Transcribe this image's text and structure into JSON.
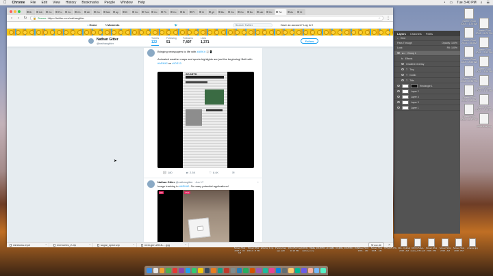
{
  "menubar": {
    "apple": "",
    "app": "Chrome",
    "items": [
      "File",
      "Edit",
      "View",
      "History",
      "Bookmarks",
      "People",
      "Window",
      "Help"
    ],
    "time": "Tue 3:40 PM"
  },
  "chrome": {
    "tabs": [
      "Bi",
      "Inb",
      "Co",
      "Pro",
      "Co",
      "Ch",
      "Ali",
      "Go",
      "Nat",
      "ap",
      "El",
      "Co",
      "Tum",
      "Co",
      "Ph",
      "Co",
      "Bi",
      "Pt",
      "hl",
      "git",
      "Bu",
      "Go",
      "Go",
      "Bc",
      "ske",
      "Ho",
      "Tw",
      "Ac",
      "Ci"
    ],
    "active_tab_index": 26,
    "url_secure": "Secure",
    "url": "https://twitter.com/nathangitter"
  },
  "twitter": {
    "nav": {
      "home": "Home",
      "moments": "Moments",
      "search_placeholder": "Search Twitter",
      "login": "Have an account? Log in ▾"
    },
    "profile": {
      "name": "Nathan Gitter",
      "handle": "@nathangitter",
      "stats": [
        {
          "label": "Tweets",
          "value": "122"
        },
        {
          "label": "Following",
          "value": "51"
        },
        {
          "label": "Followers",
          "value": "7,497"
        },
        {
          "label": "Likes",
          "value": "1,371"
        }
      ],
      "follow": "Follow"
    },
    "tweet1": {
      "line1": "Bringing newspapers to life with ",
      "line1_tag": "#ARKit",
      "line1_emoji": " 📰📱",
      "line2": "Animated weather maps and sports highlights are just the beginning! Built with ",
      "line2_tag": "#ARKit2",
      "line2_mid": " on ",
      "line2_tag2": "#iOS12",
      "line2_end": ".",
      "headline": "SPORTS",
      "replies": "180",
      "retweets": "2.5K",
      "likes": "8.4K"
    },
    "tweet2": {
      "name": "Nathan Gitter",
      "handle": "@nathangitter · Jun 17",
      "text_pre": "Image tracking in ",
      "text_tag": "#ARKit2",
      "text_post": ". So many potential applications!",
      "live": "LIVE",
      "gif": "GIF"
    }
  },
  "downloads": {
    "items": [
      "rainbows.mp4",
      "memories_2.zip",
      "sugar_spice.zip",
      "next-gen-2018-....jpg"
    ],
    "show_all": "Show All"
  },
  "photoshop": {
    "tabs": [
      "Layers",
      "Channels",
      "Paths"
    ],
    "kind": "Kind",
    "blend": "Pass Through",
    "opacity": "Opacity: 100%",
    "fill": "Fill: 100%",
    "lock": "Lock:",
    "layers": [
      "Group 1",
      "Effects",
      "Gradient Overlay",
      "Tiny",
      "Guido",
      "Title",
      "Rectangle 1",
      "Layer 2",
      "Layer 4",
      "Layer 3",
      "Layer 1"
    ]
  },
  "desktop": {
    "right_icons": [
      "Screen Shot 2018-...1.26 AM",
      "Screen Shot 2018-...5.00 PM",
      "Screen Shot 2018-...38 AM",
      "Screen Shot 2018-...2.53 PM",
      "Screen Shot 2018-...8.55 AM",
      "Screen Shot 2018-...3.59 PM",
      "Screen Shot 2018-...0.35 PM",
      "Screen Shot 2018-...1.13 PM",
      "Screen Shot 2018-...48 AM",
      "Screen Shot 2018-...8.29 PM",
      "Screen Shot 2018-...2.47 PM",
      "nameless.png"
    ],
    "bottom_icons": [
      "Screen Shot 2018-0...02 AM",
      "Screen Shot 2018-0...8 PM",
      "ariterna_1.mp",
      "Preferences app.swift",
      "2018-05-03 at 10.22 PM",
      "180611_Nyx e. nathan_1.mp",
      "IMG_20180504_ab.png",
      "IMG_04.gif",
      "IMG_20180604_16.gif",
      "Screen Shot 2018-...AM",
      "Screen Shot 2018-...AM",
      "7256435.JPG",
      "KDs - Kokbeli 2018...AM",
      "KNX.UTubet-recipe_STC.pdf",
      "Screen Shot 2018...PM",
      "Screen Shot 2018...AM",
      "Screen Shot 2018...PM",
      "ornamel.jpg"
    ]
  },
  "colors": {
    "twitter_blue": "#1da1f2",
    "photoshop_bg": "#535353"
  }
}
